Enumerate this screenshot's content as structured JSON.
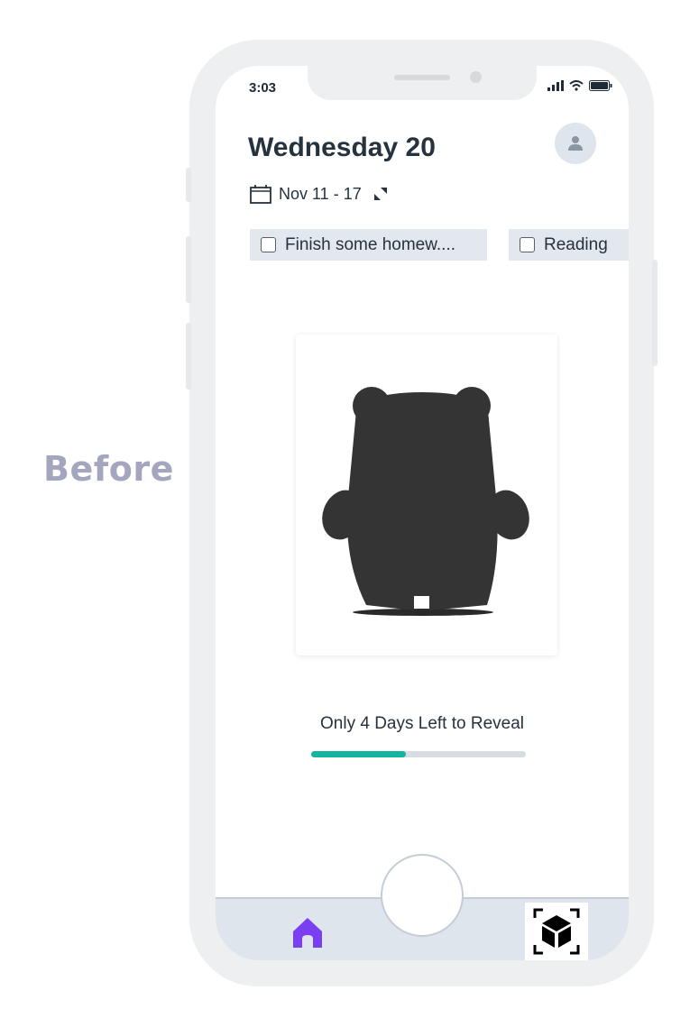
{
  "side_label": "Before",
  "status": {
    "time": "3:03",
    "icons": [
      "signal-icon",
      "wifi-icon",
      "battery-icon"
    ]
  },
  "header": {
    "title": "Wednesday 20",
    "week_range": "Nov 11 -  17"
  },
  "tasks": [
    {
      "label": "Finish some homew....",
      "checked": false
    },
    {
      "label": "Reading",
      "checked": false
    }
  ],
  "reveal": {
    "text": "Only 4 Days Left to Reveal",
    "progress_fraction": 0.44
  },
  "tabbar": {
    "items": [
      "home-icon",
      "camera-button",
      "ar-cube-icon"
    ]
  },
  "colors": {
    "accent": "#17b3a1",
    "home_icon": "#7b3ff2",
    "title": "#26323e",
    "side_label": "#a4a6bd",
    "silhouette": "#343434"
  }
}
